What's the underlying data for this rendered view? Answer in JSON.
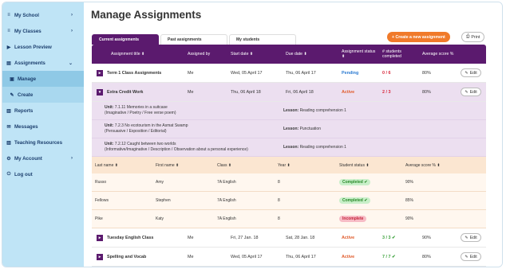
{
  "sidebar": {
    "items": [
      {
        "icon": "≡",
        "label": "My School",
        "chev": "›"
      },
      {
        "icon": "≡",
        "label": "My Classes",
        "chev": "›"
      },
      {
        "icon": "▶",
        "label": "Lesson Preview",
        "chev": ""
      },
      {
        "icon": "▤",
        "label": "Assignments",
        "chev": "⌄"
      },
      {
        "icon": "▣",
        "label": "Manage",
        "chev": ""
      },
      {
        "icon": "✎",
        "label": "Create",
        "chev": ""
      },
      {
        "icon": "▥",
        "label": "Reports",
        "chev": ""
      },
      {
        "icon": "✉",
        "label": "Messages",
        "chev": ""
      },
      {
        "icon": "▥",
        "label": "Teaching Resources",
        "chev": ""
      },
      {
        "icon": "⚙",
        "label": "My Account",
        "chev": "›"
      },
      {
        "icon": "⏻",
        "label": "Log out",
        "chev": ""
      }
    ]
  },
  "header": {
    "title": "Manage Assignments"
  },
  "tabs": [
    "Current assignments",
    "Past assignments",
    "My students"
  ],
  "actions": {
    "create": "+ Create a new assignment",
    "print": "Print",
    "print_icon": "⎙"
  },
  "table": {
    "headers": [
      "Assignment title ⬍",
      "Assigned by",
      "Start date ⬍",
      "Due date ⬍",
      "Assignment status ⬍",
      "# students completed",
      "Average score %",
      ""
    ],
    "rows": [
      {
        "toggle": "▸",
        "title": "Term 1 Class Assignments",
        "by": "Me",
        "start": "Wed, 05 April 17",
        "due": "Thu, 06 April 17",
        "status": "Pending",
        "completed": "0 / 6",
        "score": "80%",
        "edit": "Edit"
      },
      {
        "toggle": "▾",
        "title": "Extra Credit Work",
        "by": "Me",
        "start": "Thu, 06 April 18",
        "due": "Fri, 06 April 18",
        "status": "Active",
        "completed": "2 / 3",
        "score": "80%",
        "edit": "Edit"
      },
      {
        "toggle": "▸",
        "title": "Tuesday English Class",
        "by": "Me",
        "start": "Fri, 27 Jan. 18",
        "due": "Sat, 28 Jan. 18",
        "status": "Active",
        "completed": "3 / 3 ✔",
        "score": "90%",
        "edit": "Edit"
      },
      {
        "toggle": "▸",
        "title": "Spelling and Vocab",
        "by": "Me",
        "start": "Wed, 05 April 17",
        "due": "Thu, 06 April 17",
        "status": "Active",
        "completed": "7 / 7 ✔",
        "score": "80%",
        "edit": "Edit"
      }
    ],
    "units": [
      {
        "unit_label": "Unit:",
        "unit": "7.1.11 Memories in a suitcase",
        "unit_sub": "(Imaginative / Poetry / Free verse poem)",
        "lesson_label": "Lesson:",
        "lesson": "Reading comprehension 1"
      },
      {
        "unit_label": "Unit:",
        "unit": "7.2.3 No ecotourism in the Asmat Swamp",
        "unit_sub": "(Persuasive / Exposition / Editorial)",
        "lesson_label": "Lesson:",
        "lesson": "Punctuation"
      },
      {
        "unit_label": "Unit:",
        "unit": "7.2.12 Caught between two worlds",
        "unit_sub": "(Informative/Imaginative / Description / Observation about a personal experience)",
        "lesson_label": "Lesson:",
        "lesson": "Reading comprehension 1"
      }
    ],
    "student_headers": [
      "Last name ⬍",
      "First name ⬍",
      "Class ⬍",
      "Year ⬍",
      "Student status ⬍",
      "Average score % ⬍"
    ],
    "students": [
      {
        "last": "Russo",
        "first": "Amy",
        "class": "7A English",
        "year": "8",
        "status": "Completed ✔",
        "status_type": "completed",
        "score": "90%"
      },
      {
        "last": "Fellows",
        "first": "Stephen",
        "class": "7A English",
        "year": "8",
        "status": "Completed ✔",
        "status_type": "completed",
        "score": "85%"
      },
      {
        "last": "Pike",
        "first": "Katy",
        "class": "7A English",
        "year": "8",
        "status": "Incomplete",
        "status_type": "incomplete",
        "score": "90%"
      }
    ]
  },
  "colors": {
    "purple": "#5b1a6e",
    "orange": "#f07a2a",
    "sidebar": "#bfe4f6"
  }
}
